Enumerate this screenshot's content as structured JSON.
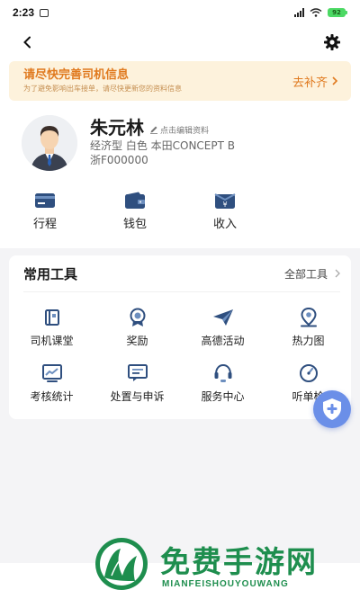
{
  "status": {
    "time": "2:23",
    "battery": "92"
  },
  "banner": {
    "title": "请尽快完善司机信息",
    "subtitle": "为了避免影响出车接单，请尽快更新您的资料信息",
    "action": "去补齐"
  },
  "profile": {
    "name": "朱元林",
    "edit_hint": "点击编辑资料",
    "car_info": "经济型 白色 本田CONCEPT B",
    "plate": "浙F000000"
  },
  "quick": [
    {
      "label": "行程",
      "icon": "trip-card-icon"
    },
    {
      "label": "钱包",
      "icon": "wallet-icon"
    },
    {
      "label": "收入",
      "icon": "income-icon"
    }
  ],
  "tools": {
    "title": "常用工具",
    "all_label": "全部工具",
    "items": [
      {
        "label": "司机课堂",
        "icon": "book-icon"
      },
      {
        "label": "奖励",
        "icon": "medal-icon"
      },
      {
        "label": "高德活动",
        "icon": "paper-plane-icon"
      },
      {
        "label": "热力图",
        "icon": "map-pin-icon"
      },
      {
        "label": "考核统计",
        "icon": "chart-icon"
      },
      {
        "label": "处置与申诉",
        "icon": "message-icon"
      },
      {
        "label": "服务中心",
        "icon": "headset-icon"
      },
      {
        "label": "听单检",
        "icon": "gauge-icon"
      }
    ]
  },
  "watermark": {
    "title": "免费手游网",
    "subtitle": "MIANFEISHOUYOUWANG"
  },
  "colors": {
    "accent": "#e07a1f",
    "banner_bg": "#fdf2dc",
    "icon_blue": "#2f4f7f",
    "fab": "#6b8fe8",
    "watermark": "#1e8e4e"
  }
}
